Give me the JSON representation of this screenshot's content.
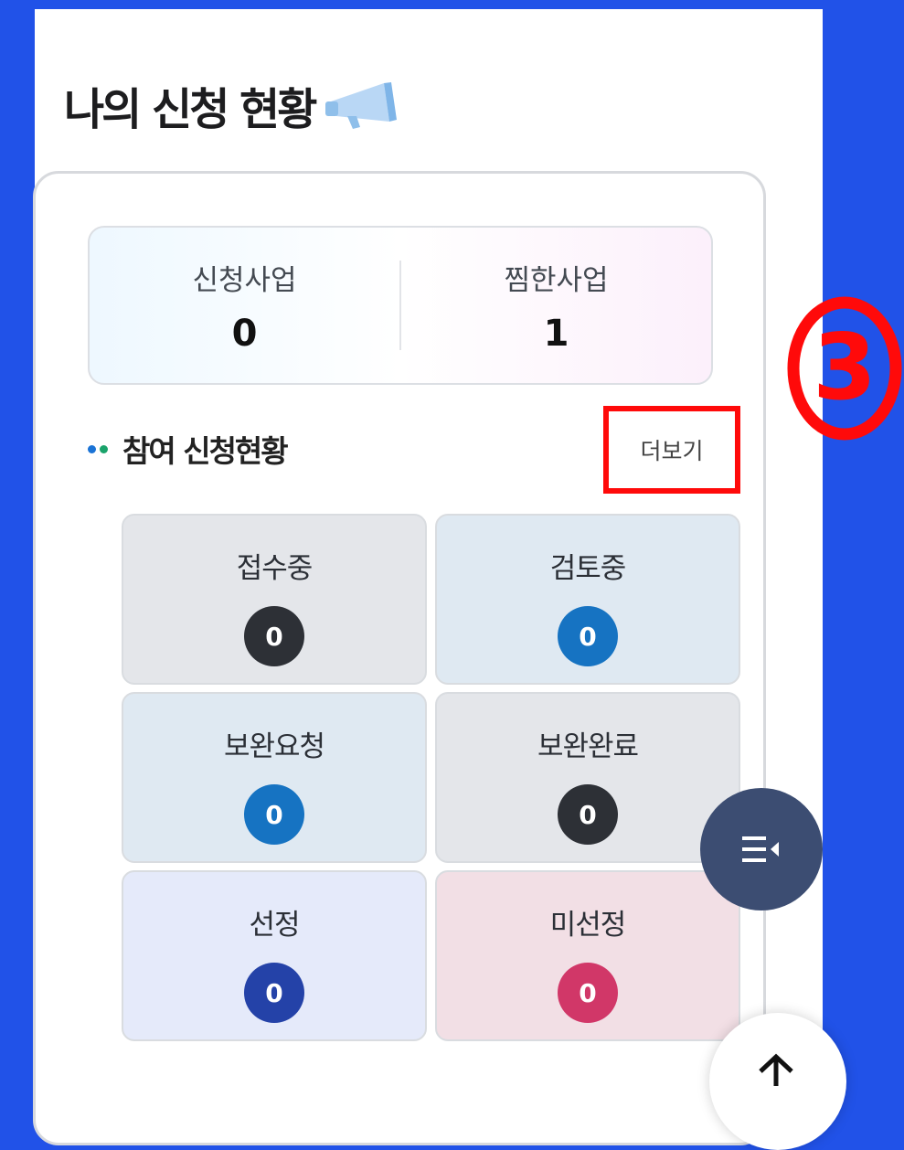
{
  "page": {
    "title": "나의 신청 현황",
    "title_icon": "megaphone-icon"
  },
  "summary": {
    "applied_label": "신청사업",
    "applied_value": "0",
    "saved_label": "찜한사업",
    "saved_value": "1"
  },
  "section": {
    "title": "참여 신청현황",
    "more_label": "더보기",
    "dot_colors": [
      "#1a73d6",
      "#1aa36b"
    ]
  },
  "annotation": {
    "step_number": "3",
    "color": "#ff0a0a"
  },
  "status_tiles": [
    {
      "label": "접수중",
      "count": "0",
      "bg": "#e4e6ea",
      "badge": "#2d3036"
    },
    {
      "label": "검토중",
      "count": "0",
      "bg": "#dfe9f2",
      "badge": "#1673c2"
    },
    {
      "label": "보완요청",
      "count": "0",
      "bg": "#dfe9f2",
      "badge": "#1673c2"
    },
    {
      "label": "보완완료",
      "count": "0",
      "bg": "#e4e6ea",
      "badge": "#2d3036"
    },
    {
      "label": "선정",
      "count": "0",
      "bg": "#e5eafa",
      "badge": "#2442a8"
    },
    {
      "label": "미선정",
      "count": "0",
      "bg": "#f2dfe5",
      "badge": "#d13768"
    }
  ],
  "floating": {
    "menu_icon": "menu-collapse-icon",
    "top_icon": "arrow-up-icon"
  }
}
